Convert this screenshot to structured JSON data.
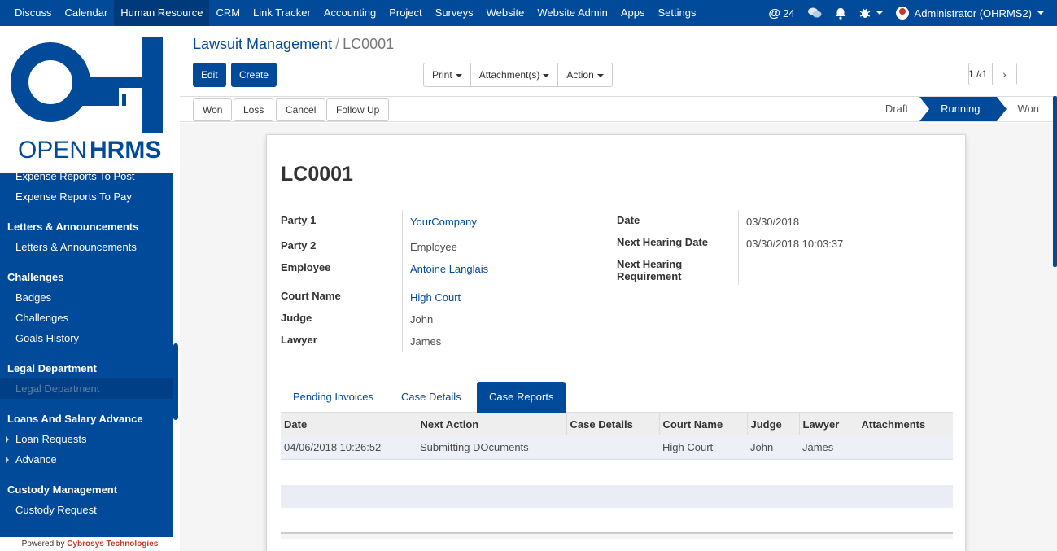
{
  "topbar": {
    "menu": [
      "Discuss",
      "Calendar",
      "Human Resource",
      "CRM",
      "Link Tracker",
      "Accounting",
      "Project",
      "Surveys",
      "Website",
      "Website Admin",
      "Apps",
      "Settings"
    ],
    "active_menu": "Human Resource",
    "mentions_count": "24",
    "user": "Administrator (OHRMS2)"
  },
  "logo": {
    "line1": "OPEN",
    "line2": "HRMS"
  },
  "sidebar": {
    "items": [
      {
        "type": "item",
        "label": "Expense Reports To Post"
      },
      {
        "type": "item",
        "label": "Expense Reports To Pay"
      },
      {
        "type": "section",
        "label": "Letters & Announcements"
      },
      {
        "type": "item",
        "label": "Letters & Announcements"
      },
      {
        "type": "section",
        "label": "Challenges"
      },
      {
        "type": "item",
        "label": "Badges"
      },
      {
        "type": "item",
        "label": "Challenges"
      },
      {
        "type": "item",
        "label": "Goals History"
      },
      {
        "type": "section",
        "label": "Legal Department"
      },
      {
        "type": "item",
        "label": "Legal Department",
        "active": true
      },
      {
        "type": "section",
        "label": "Loans And Salary Advance"
      },
      {
        "type": "item",
        "label": "Loan Requests",
        "expandable": true
      },
      {
        "type": "item",
        "label": "Advance",
        "expandable": true
      },
      {
        "type": "section",
        "label": "Custody Management"
      },
      {
        "type": "item",
        "label": "Custody Request"
      }
    ],
    "powered_by": "Powered by",
    "powered_company": "Cybrosys Technologies"
  },
  "breadcrumb": {
    "parent": "Lawsuit Management",
    "current": "LC0001"
  },
  "buttons": {
    "edit": "Edit",
    "create": "Create",
    "print": "Print",
    "attachments": "Attachment(s)",
    "action": "Action"
  },
  "pager": {
    "value": "1 / 1"
  },
  "status_buttons": [
    "Won",
    "Loss",
    "Cancel",
    "Follow Up"
  ],
  "stages": {
    "draft": "Draft",
    "running": "Running",
    "won": "Won",
    "active": "Running"
  },
  "record": {
    "name": "LC0001",
    "party1_label": "Party 1",
    "party1": "YourCompany",
    "party2_label": "Party 2",
    "party2": "Employee",
    "employee_label": "Employee",
    "employee": "Antoine Langlais",
    "court_label": "Court Name",
    "court": "High Court",
    "judge_label": "Judge",
    "judge": "John",
    "lawyer_label": "Lawyer",
    "lawyer": "James",
    "date_label": "Date",
    "date": "03/30/2018",
    "next_hearing_label": "Next Hearing Date",
    "next_hearing": "03/30/2018 10:03:37",
    "requirement_label_1": "Next Hearing",
    "requirement_label_2": "Requirement"
  },
  "tabs": [
    "Pending Invoices",
    "Case Details",
    "Case Reports"
  ],
  "active_tab": "Case Reports",
  "table": {
    "columns": [
      "Date",
      "Next Action",
      "Case Details",
      "Court Name",
      "Judge",
      "Lawyer",
      "Attachments"
    ],
    "rows": [
      [
        "04/06/2018 10:26:52",
        "Submitting DOcuments",
        "",
        "High Court",
        "John",
        "James",
        ""
      ]
    ]
  }
}
